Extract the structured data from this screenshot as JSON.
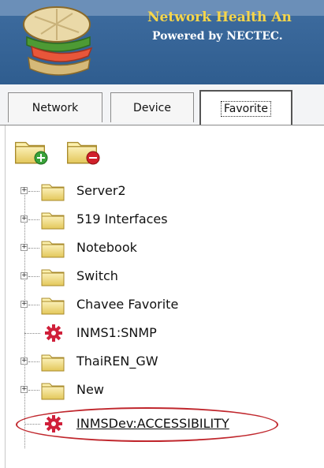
{
  "header": {
    "title": "Network Health An",
    "subtitle": "Powered by NECTEC."
  },
  "tabs": [
    {
      "label": "Network",
      "active": false
    },
    {
      "label": "Device",
      "active": false
    },
    {
      "label": "Favorite",
      "active": true
    }
  ],
  "toolbar": {
    "add_folder_icon": "folder-add-icon",
    "remove_folder_icon": "folder-remove-icon"
  },
  "tree": {
    "items": [
      {
        "label": "Server2",
        "type": "folder",
        "expandable": true
      },
      {
        "label": "519 Interfaces",
        "type": "folder",
        "expandable": true
      },
      {
        "label": "Notebook",
        "type": "folder",
        "expandable": true
      },
      {
        "label": "Switch",
        "type": "folder",
        "expandable": true
      },
      {
        "label": "Chavee Favorite",
        "type": "folder",
        "expandable": true
      },
      {
        "label": "INMS1:SNMP",
        "type": "device",
        "expandable": false
      },
      {
        "label": "ThaiREN_GW",
        "type": "folder",
        "expandable": true
      },
      {
        "label": "New",
        "type": "folder",
        "expandable": true
      },
      {
        "label": "INMSDev:ACCESSIBILITY",
        "type": "device",
        "expandable": false,
        "highlighted": true
      }
    ]
  },
  "colors": {
    "header_bg": "#3f6da0",
    "title": "#f7d64a",
    "highlight_ring": "#c0272d",
    "device_gear": "#d0203a",
    "folder": "#f3d56a"
  }
}
